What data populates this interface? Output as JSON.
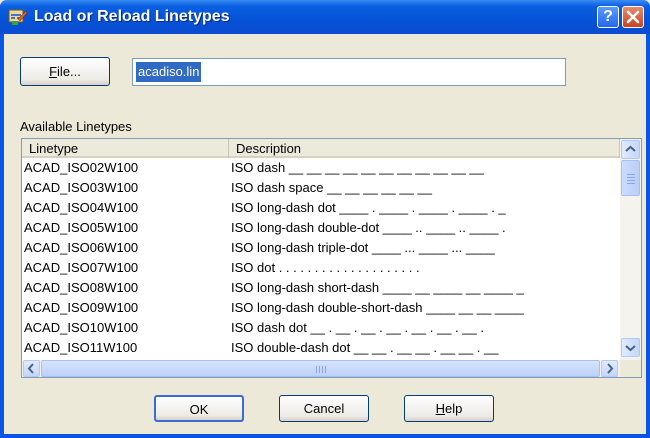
{
  "window": {
    "title": "Load or Reload Linetypes",
    "help_glyph": "?",
    "close_glyph": "×"
  },
  "file": {
    "button_label": "File...",
    "button_mnemonic": "F",
    "button_rest": "ile...",
    "value": "acadiso.lin"
  },
  "list": {
    "label": "Available Linetypes",
    "columns": [
      "Linetype",
      "Description"
    ],
    "rows": [
      {
        "name": "ACAD_ISO02W100",
        "description": "ISO dash __ __ __ __ __ __ __ __ __ __ __"
      },
      {
        "name": "ACAD_ISO03W100",
        "description": "ISO dash space __    __    __    __    __    __"
      },
      {
        "name": "ACAD_ISO04W100",
        "description": "ISO long-dash dot ____ . ____ . ____ . ____ . _"
      },
      {
        "name": "ACAD_ISO05W100",
        "description": "ISO long-dash double-dot ____ .. ____ .. ____ ."
      },
      {
        "name": "ACAD_ISO06W100",
        "description": "ISO long-dash triple-dot ____ ... ____ ... ____"
      },
      {
        "name": "ACAD_ISO07W100",
        "description": "ISO dot . . . . . . . . . . . . . . . . . . . ."
      },
      {
        "name": "ACAD_ISO08W100",
        "description": "ISO long-dash short-dash ____ __ ____ __ ____ _"
      },
      {
        "name": "ACAD_ISO09W100",
        "description": "ISO long-dash double-short-dash ____ __ __ ____"
      },
      {
        "name": "ACAD_ISO10W100",
        "description": "ISO dash dot __ . __ . __ . __ . __ . __ . __ ."
      },
      {
        "name": "ACAD_ISO11W100",
        "description": "ISO double-dash dot __ __ . __ __ . __ __ . __"
      }
    ]
  },
  "buttons": {
    "ok": "OK",
    "cancel": "Cancel",
    "help_mnemonic": "H",
    "help_rest": "elp"
  },
  "colors": {
    "title_bar": "#0552d8",
    "selection": "#316ac5",
    "dialog_bg": "#ece9d8"
  }
}
